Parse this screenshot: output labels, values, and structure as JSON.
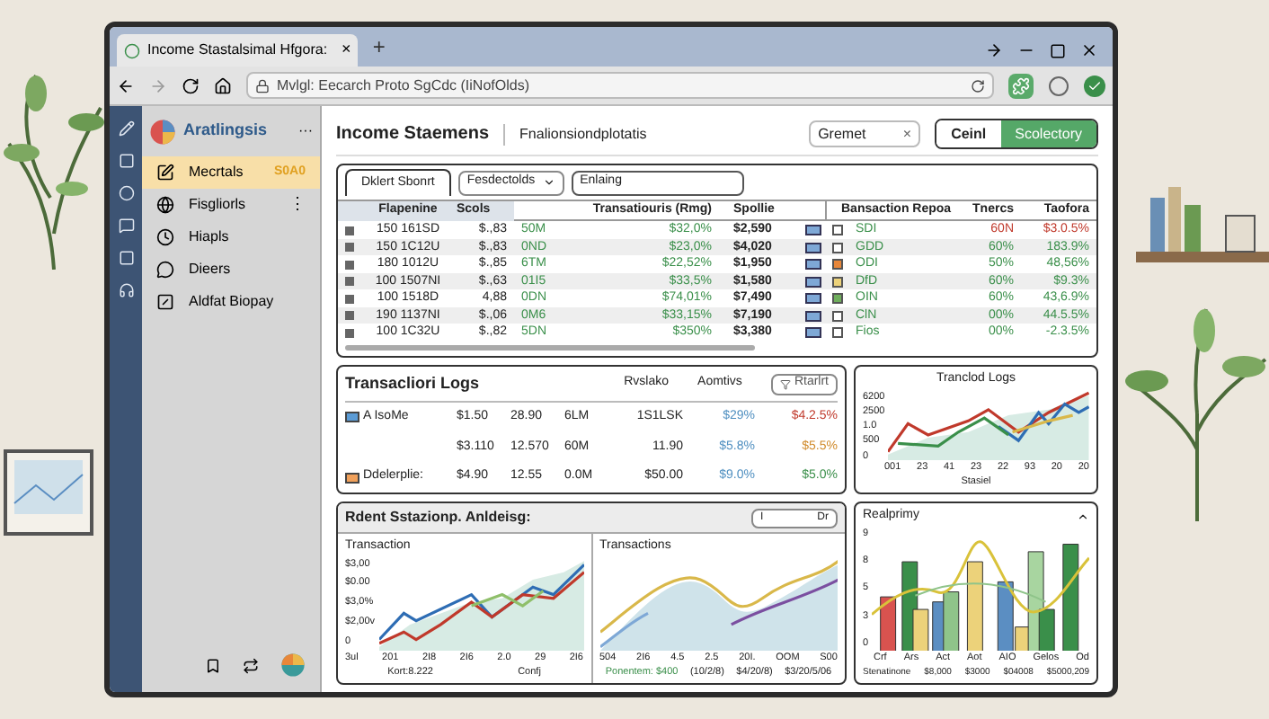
{
  "browser": {
    "tab_title": "Income Stastalsimal Hfgora:",
    "tab_close": "×",
    "new_tab": "+",
    "address": "Mvlgl: Eecarch Proto SgCdc (IiNofOlds)"
  },
  "sidebar": {
    "brand": "Aratlingsis",
    "more": "···",
    "items": [
      {
        "label": "Mecrtals",
        "badge": "S0A0",
        "selected": true
      },
      {
        "label": "Fisgliorls",
        "menu": "⋮",
        "selected": false
      },
      {
        "label": "Hiapls",
        "selected": false
      },
      {
        "label": "Dieers",
        "selected": false
      },
      {
        "label": "Aldfat Biopay",
        "selected": false
      }
    ]
  },
  "header": {
    "title": "Income Staemens",
    "subtitle": "Fnalionsiondplotatis",
    "search": "Gremet",
    "clear": "×",
    "buttons": [
      {
        "label": "Ceinl",
        "primary": false
      },
      {
        "label": "Scolectory",
        "primary": true
      }
    ]
  },
  "table": {
    "tabs": [
      {
        "label": "Dklert Sbonrt",
        "selected": true
      }
    ],
    "dropdown": "Fesdectolds",
    "filter": "Enlaing",
    "columns": [
      "Flapenine",
      "Scols",
      "Transatiouris (Rmg)",
      "Spollie",
      "Bansaction Repoa",
      "Tnercs",
      "Taofora"
    ],
    "rows": [
      {
        "id": "150 161SD",
        "amount": "$.,83",
        "code": "50M",
        "rate": "$32,0%",
        "total": "$2,590",
        "tag": "SDI",
        "share": "60N",
        "change": "$3.0.5%",
        "negative": true,
        "checked": false
      },
      {
        "id": "150 1C12U",
        "amount": "$.,83",
        "code": "0ND",
        "rate": "$23,0%",
        "total": "$4,020",
        "tag": "GDD",
        "share": "60%",
        "change": "183.9%",
        "negative": false,
        "checked": false
      },
      {
        "id": "180 1012U",
        "amount": "$.,85",
        "code": "6TM",
        "rate": "$22,52%",
        "total": "$1,950",
        "color": "#e8873a",
        "tag": "ODI",
        "share": "50%",
        "change": "48,56%",
        "negative": false,
        "checked": true
      },
      {
        "id": "100 1507NI",
        "amount": "$.,63",
        "code": "01I5",
        "rate": "$33,5%",
        "total": "$1,580",
        "color": "#ecd27a",
        "tag": "DfD",
        "share": "60%",
        "change": "$9.3%",
        "negative": false,
        "checked": true
      },
      {
        "id": "100 1518D",
        "amount": "4,88",
        "code": "0DN",
        "rate": "$74,01%",
        "total": "$7,490",
        "color": "#6fae5c",
        "tag": "OIN",
        "share": "60%",
        "change": "43,6.9%",
        "negative": false,
        "checked": true
      },
      {
        "id": "190 1137NI",
        "amount": "$.,06",
        "code": "0M6",
        "rate": "$33,15%",
        "total": "$7,190",
        "tag": "ClN",
        "share": "00%",
        "change": "44.5.5%",
        "negative": false,
        "checked": false
      },
      {
        "id": "100 1C32U",
        "amount": "$.,82",
        "code": "5DN",
        "rate": "$350%",
        "total": "$3,380",
        "tag": "Fios",
        "share": "00%",
        "change": "-2.3.5%",
        "negative": false,
        "checked": false
      }
    ]
  },
  "logs": {
    "title": "Transacliori Logs",
    "columns": [
      "Rvslako",
      "Aomtivs"
    ],
    "button": "Rtarlrt",
    "rows": [
      {
        "color": "#5b9bd5",
        "label": "A IsoMe",
        "cells": [
          "$1.50",
          "28.90",
          "6LM"
        ],
        "value": "1S1LSK",
        "percent": "$29%",
        "change": "$4.2.5%",
        "negative": true,
        "warning": false
      },
      {
        "cells": [
          "$3.110",
          "12.570",
          "60M"
        ],
        "value": "11.90",
        "percent": "$5.8%",
        "change": "$5.5%",
        "negative": false,
        "warning": true
      },
      {
        "color": "#f0a05a",
        "label": "Ddelerplie:",
        "cells": [
          "$4.90",
          "12.55",
          "0.0M"
        ],
        "value": "$50.00",
        "percent": "$9.0%",
        "change": "$5.0%",
        "negative": false,
        "warning": false
      }
    ]
  },
  "trend_chart": {
    "title": "Tranclod Logs",
    "y_labels": [
      "6200",
      "2500",
      "1.0",
      "500",
      "0"
    ],
    "x_labels": [
      "001",
      "23",
      "41",
      "23",
      "22",
      "93",
      "20",
      "20"
    ],
    "xlabel": "Stasiel"
  },
  "analysis": {
    "title": "Rdent Sstazionp. Anldeisg:",
    "field_left": "I",
    "field_right": "Dr",
    "charts": [
      {
        "title": "Transaction",
        "y_labels": [
          "$3,00",
          "$0.00",
          "$3,0%",
          "$2,00v",
          "0"
        ],
        "x_labels": [
          "3ul",
          "201",
          "2I8",
          "2I6",
          "2.0",
          "29",
          "2I6"
        ],
        "footer": [
          "Kort:8.222",
          "Confj"
        ]
      },
      {
        "title": "Transactions",
        "x_labels": [
          "504",
          "2I6",
          "4.5",
          "2.5",
          "20I.",
          "OOM",
          "S00"
        ],
        "footer": [
          "Ponentem: $400",
          "(10/2/8)",
          "$4/20/8)",
          "$3/20/5/06"
        ]
      }
    ]
  },
  "bar_chart": {
    "title": "Realprimy",
    "y_labels": [
      "9",
      "8",
      "5",
      "3",
      "0"
    ],
    "x_labels": [
      "Crf",
      "Ars",
      "Act",
      "Aot",
      "AIO",
      "Gelos",
      "Od"
    ],
    "footer": [
      "Stenatinone",
      "$8,000",
      "$3000",
      "$04008",
      "$5000,209"
    ]
  }
}
